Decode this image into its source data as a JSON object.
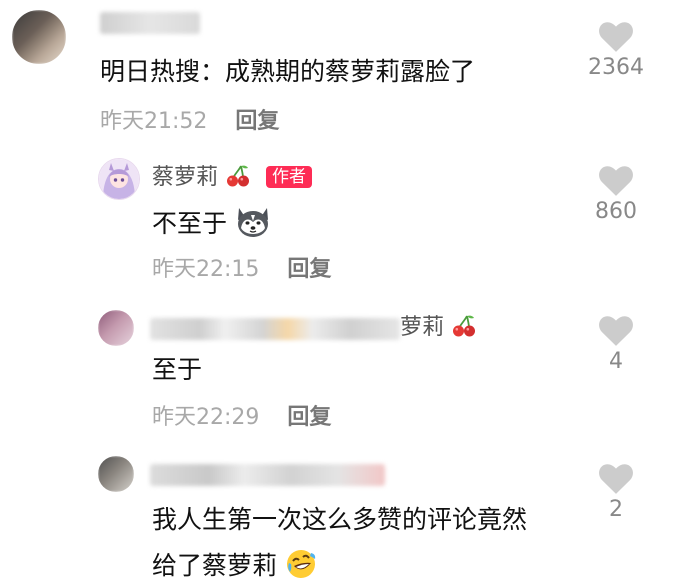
{
  "comments": [
    {
      "text": "明日热搜：成熟期的蔡萝莉露脸了",
      "timestamp": "昨天21:52",
      "reply_label": "回复",
      "likes": "2364"
    },
    {
      "username": "蔡萝莉",
      "badge": "作者",
      "text": "不至于",
      "text_emoji": "husky-dog-emoji-icon",
      "timestamp": "昨天22:15",
      "reply_label": "回复",
      "likes": "860"
    },
    {
      "username_visible_part": "萝莉",
      "text": "至于",
      "timestamp": "昨天22:29",
      "reply_label": "回复",
      "likes": "4"
    },
    {
      "text_line1": "我人生第一次这么多赞的评论竟然",
      "text_line2": "给了蔡萝莉",
      "text_emoji": "rolling-laughing-emoji-icon",
      "likes": "2"
    }
  ],
  "colors": {
    "author_badge": "#fe2c55",
    "like_icon": "#cccccc",
    "timestamp": "#a8a8a8"
  }
}
